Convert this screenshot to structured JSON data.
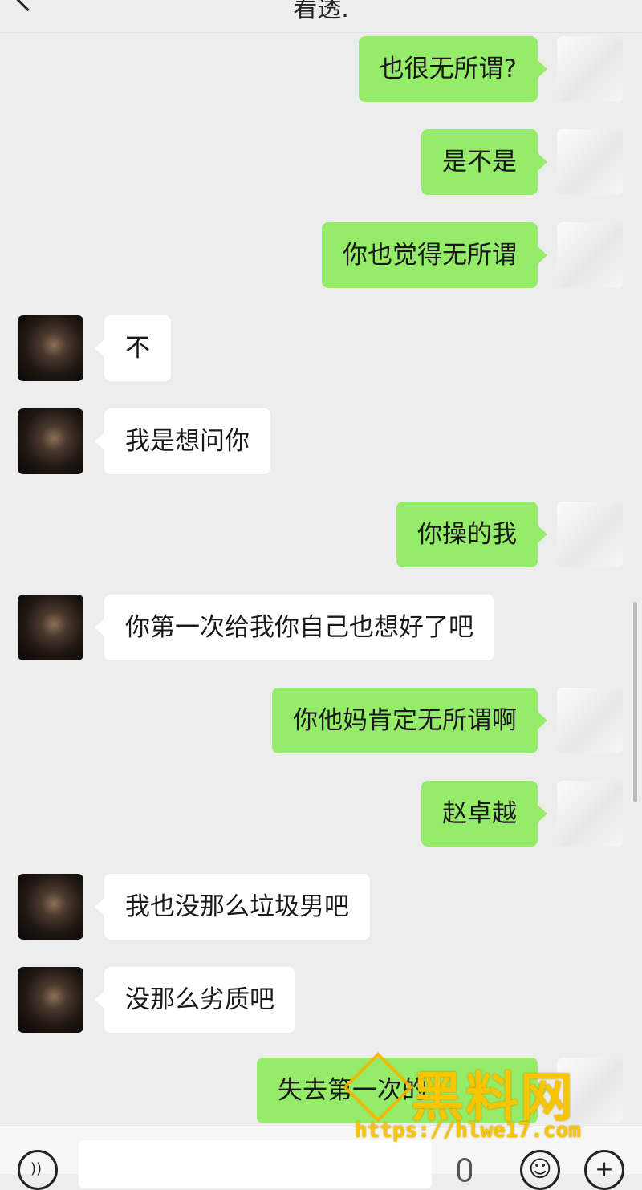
{
  "header": {
    "title": "看透."
  },
  "messages": [
    {
      "side": "me",
      "text": "也很无所谓?"
    },
    {
      "side": "me",
      "text": "是不是"
    },
    {
      "side": "me",
      "text": "你也觉得无所谓"
    },
    {
      "side": "other",
      "text": "不"
    },
    {
      "side": "other",
      "text": "我是想问你"
    },
    {
      "side": "me",
      "text": "你操的我"
    },
    {
      "side": "other",
      "text": "你第一次给我你自己也想好了吧"
    },
    {
      "side": "me",
      "text": "你他妈肯定无所谓啊"
    },
    {
      "side": "me",
      "text": "赵卓越"
    },
    {
      "side": "other",
      "text": "我也没那么垃圾男吧"
    },
    {
      "side": "other",
      "text": "没那么劣质吧"
    },
    {
      "side": "me",
      "text": "失去第一次的…"
    }
  ],
  "input_bar": {
    "voice_icon": "voice-icon",
    "emoji_icon": "emoji-icon",
    "plus_icon": "plus-icon",
    "mic_icon": "mic-icon"
  },
  "watermark": {
    "brand": "黑料网",
    "url": "https://hlwe17.com"
  }
}
